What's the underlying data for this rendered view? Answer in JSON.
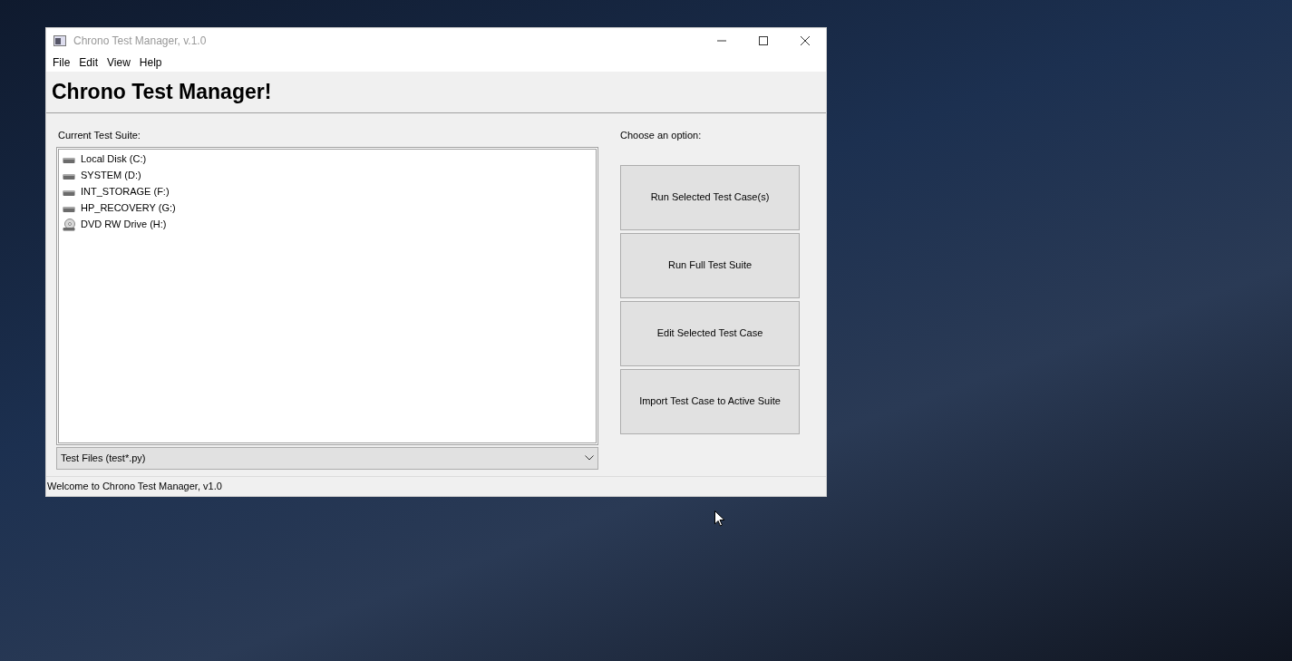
{
  "window": {
    "title": "Chrono Test Manager, v.1.0"
  },
  "menu": [
    "File",
    "Edit",
    "View",
    "Help"
  ],
  "heading": "Chrono Test Manager!",
  "suite": {
    "label": "Current Test Suite:",
    "items": [
      {
        "label": "Local Disk (C:)",
        "kind": "disk"
      },
      {
        "label": "SYSTEM (D:)",
        "kind": "disk"
      },
      {
        "label": "INT_STORAGE (F:)",
        "kind": "disk"
      },
      {
        "label": "HP_RECOVERY (G:)",
        "kind": "disk"
      },
      {
        "label": "DVD RW Drive (H:)",
        "kind": "optical"
      }
    ],
    "filter": "Test Files (test*.py)"
  },
  "options": {
    "label": "Choose an option:",
    "buttons": [
      "Run Selected Test Case(s)",
      "Run Full Test Suite",
      "Edit Selected Test Case",
      "Import Test Case to Active Suite"
    ]
  },
  "status_bar": "Welcome to Chrono Test Manager, v1.0"
}
